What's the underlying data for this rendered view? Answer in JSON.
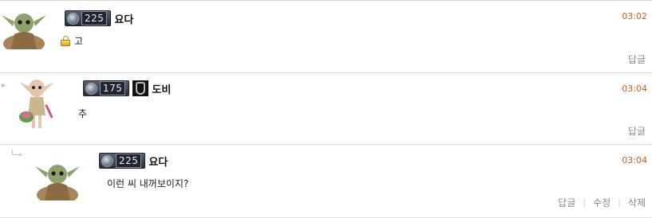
{
  "comments": [
    {
      "author": "요다",
      "level": "225",
      "time": "03:02",
      "text": "고",
      "actions": [
        "답글"
      ]
    },
    {
      "author": "도비",
      "level": "175",
      "time": "03:04",
      "text": "추",
      "actions": [
        "답글"
      ]
    },
    {
      "author": "요다",
      "level": "225",
      "time": "03:04",
      "text": "이런 씨 내꺼보이지?",
      "actions": [
        "답글",
        "수정",
        "삭제"
      ]
    }
  ],
  "colors": {
    "timestamp": "#d25a1e",
    "action_text": "#888888",
    "divider": "#dcdcdc"
  },
  "icons": [
    "lock-icon",
    "level-badge-icon",
    "dobby-badge-icon",
    "reply-arrow-icon"
  ]
}
